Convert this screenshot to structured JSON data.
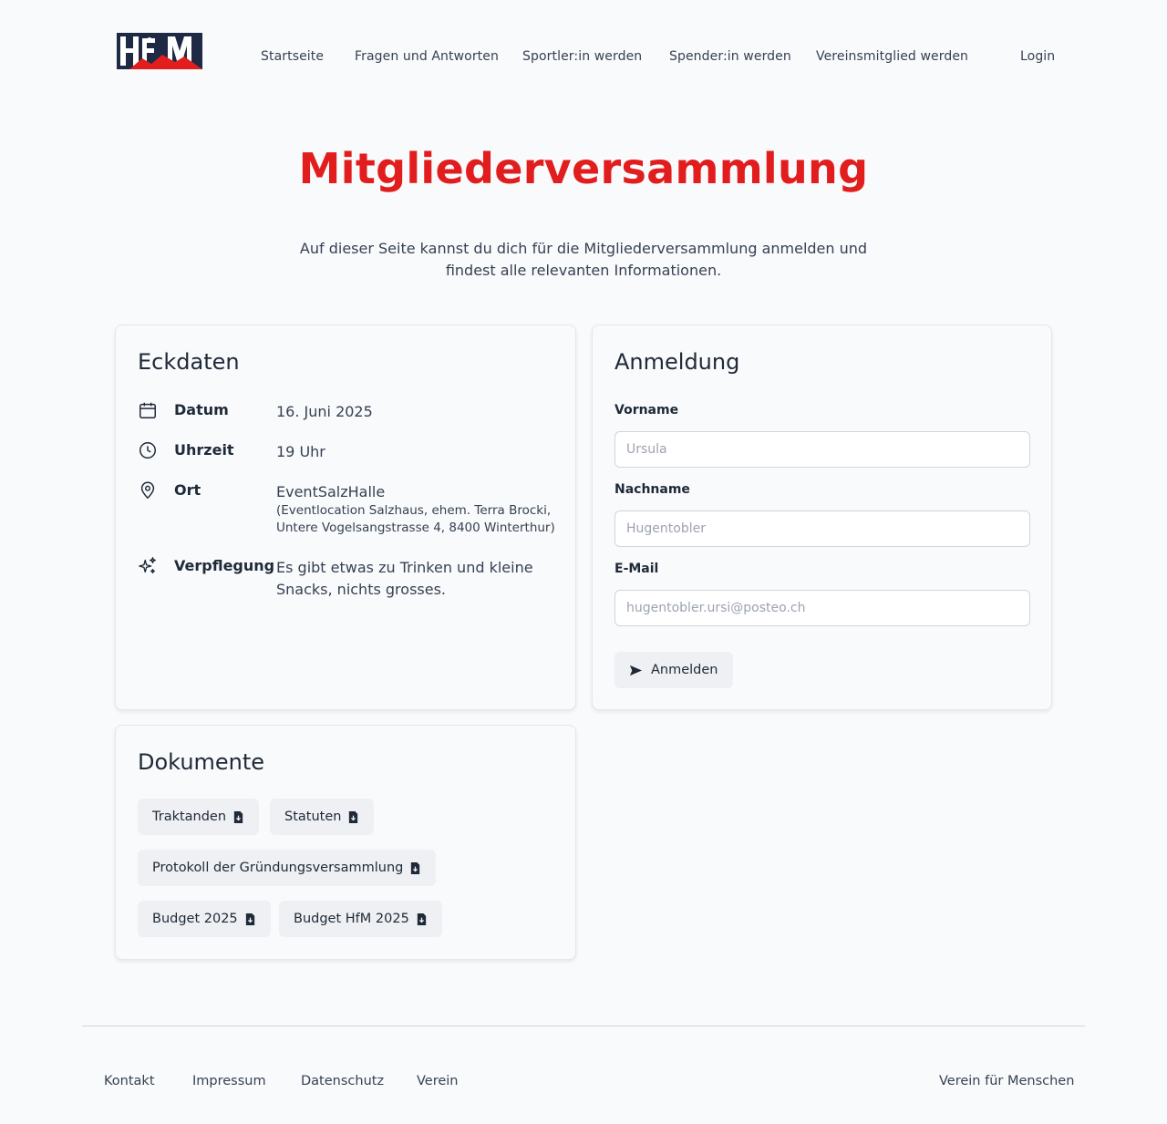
{
  "header": {
    "logo_alt": "HfM",
    "nav": [
      "Startseite",
      "Fragen und Antworten",
      "Sportler:in werden",
      "Spender:in werden",
      "Vereinsmitglied werden"
    ],
    "login": "Login"
  },
  "hero": {
    "title": "Mitgliederversammlung",
    "subtitle": "Auf dieser Seite kannst du dich für die Mitgliederversammlung anmelden und findest alle relevanten Informationen."
  },
  "eckdaten": {
    "title": "Eckdaten",
    "datum": {
      "label": "Datum",
      "value": "16. Juni 2025",
      "icon": "calendar-icon"
    },
    "uhrzeit": {
      "label": "Uhrzeit",
      "value": "19 Uhr",
      "icon": "clock-icon"
    },
    "ort": {
      "label": "Ort",
      "value": "EventSalzHalle",
      "detail": "(Eventlocation Salzhaus, ehem. Terra Brocki, Untere Vogelsangstrasse 4, 8400 Winterthur)",
      "icon": "map-pin-icon"
    },
    "verpflegung": {
      "label": "Verpflegung",
      "value": "Es gibt etwas zu Trinken und kleine Snacks, nichts grosses.",
      "icon": "sparkles-icon"
    }
  },
  "anmeldung": {
    "title": "Anmeldung",
    "vorname_label": "Vorname",
    "vorname_placeholder": "Ursula",
    "nachname_label": "Nachname",
    "nachname_placeholder": "Hugentobler",
    "email_label": "E-Mail",
    "email_placeholder": "hugentobler.ursi@posteo.ch",
    "submit": "Anmelden"
  },
  "dokumente": {
    "title": "Dokumente",
    "items": [
      "Traktanden",
      "Statuten",
      "Protokoll der Gründungsversammlung",
      "Budget 2025",
      "Budget HfM 2025"
    ]
  },
  "footer": {
    "links": [
      "Kontakt",
      "Impressum",
      "Datenschutz",
      "Verein"
    ],
    "tagline": "Verein für Menschen"
  },
  "colors": {
    "accent": "#e11d1d",
    "navy": "#1e2a44"
  }
}
